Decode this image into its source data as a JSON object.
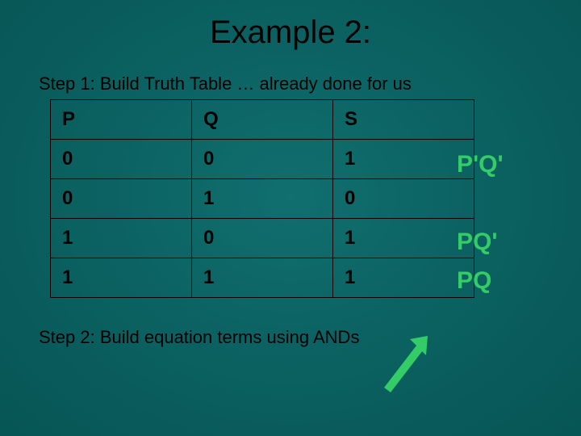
{
  "title": "Example 2:",
  "step1": "Step 1:  Build Truth Table … already done for us",
  "step2": "Step 2:  Build equation terms using ANDs",
  "table": {
    "headers": {
      "c0": "P",
      "c1": "Q",
      "c2": "S"
    },
    "rows": [
      {
        "p": "0",
        "q": "0",
        "s": "1"
      },
      {
        "p": "0",
        "q": "1",
        "s": "0"
      },
      {
        "p": "1",
        "q": "0",
        "s": "1"
      },
      {
        "p": "1",
        "q": "1",
        "s": "1"
      }
    ]
  },
  "minterms": {
    "r0": "P'Q'",
    "r1": "",
    "r2": "PQ'",
    "r3": "PQ"
  },
  "arrow_name": "arrow-up-right"
}
